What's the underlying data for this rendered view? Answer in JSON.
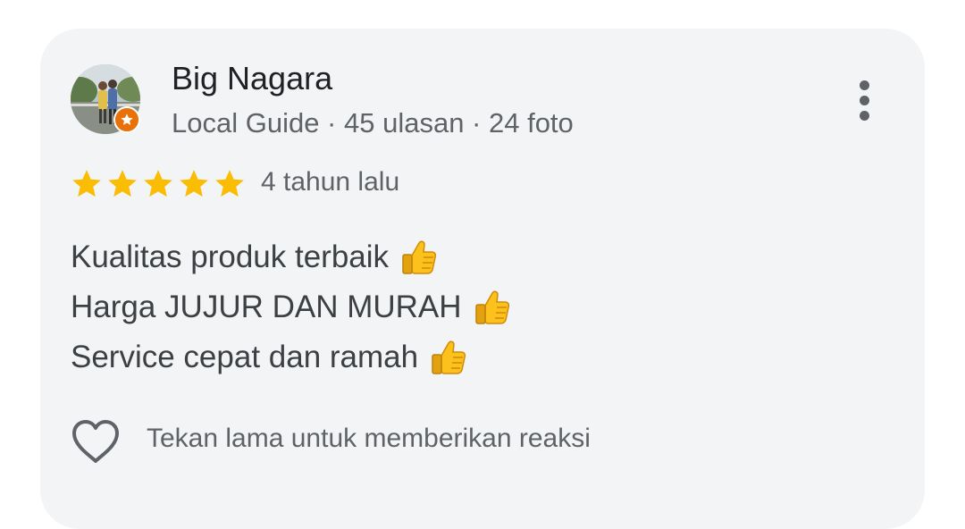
{
  "review": {
    "author_name": "Big Nagara",
    "author_meta": "Local Guide · 45 ulasan · 24 foto",
    "rating": 5,
    "rating_max": 5,
    "time": "4 tahun lalu",
    "text_lines": [
      "Kualitas produk terbaik",
      "Harga JUJUR DAN MURAH",
      "Service cepat dan ramah"
    ],
    "line_icon": "thumbs-up-icon",
    "reaction_hint": "Tekan lama untuk memberikan reaksi",
    "reaction_icon": "heart-outline-icon",
    "more_icon": "more-vert-icon",
    "badge_icon": "local-guide-star-icon"
  },
  "colors": {
    "card_background": "#f3f4f6",
    "star": "#fbbc04",
    "guide_badge": "#e8710a",
    "primary_text": "#202124",
    "secondary_text": "#5f6368"
  }
}
